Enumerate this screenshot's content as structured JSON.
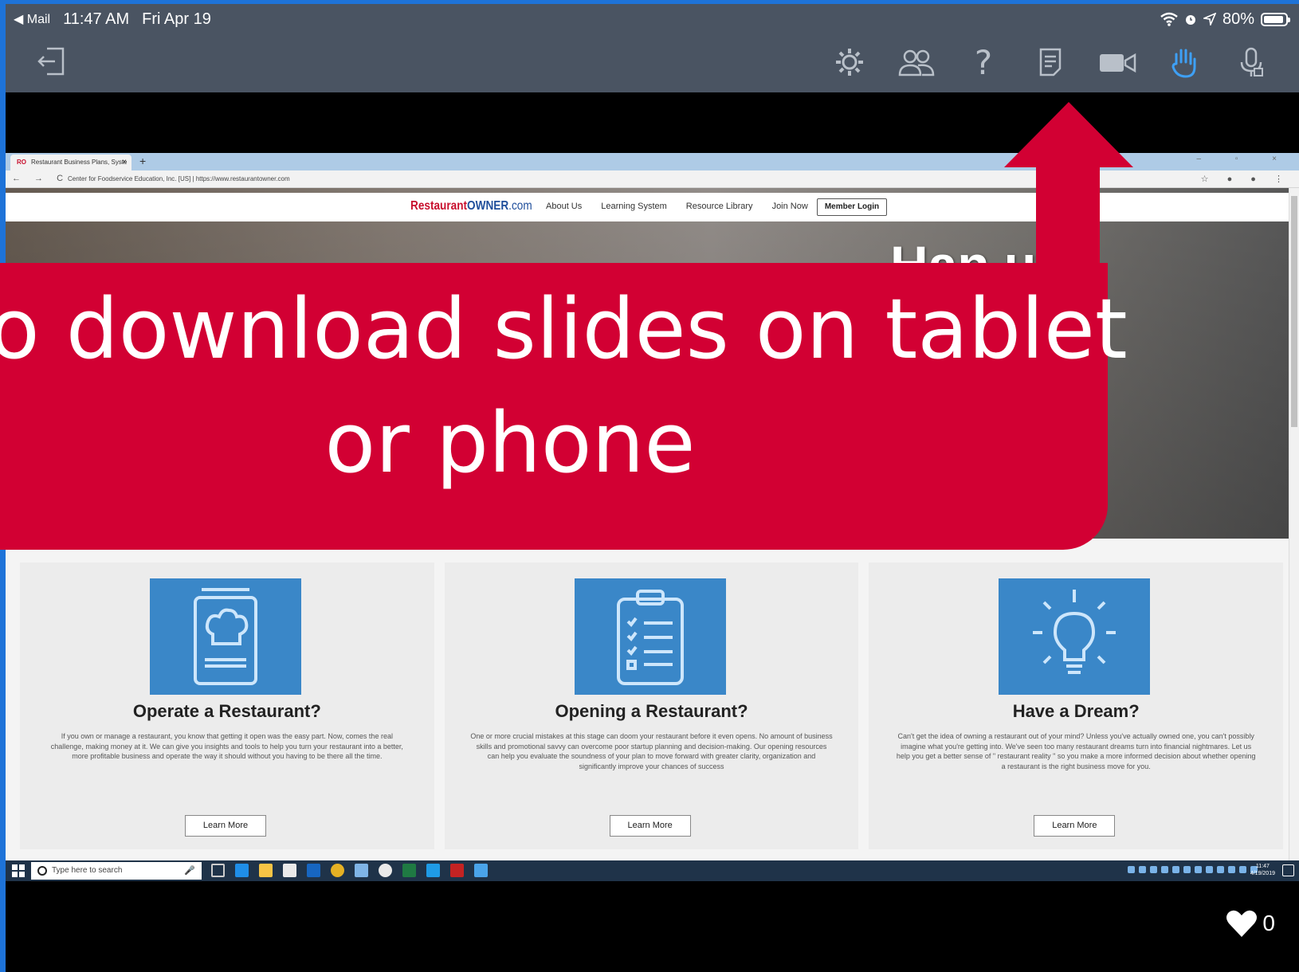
{
  "status_bar": {
    "back_label": "◀ Mail",
    "time": "11:47 AM",
    "date": "Fri Apr 19",
    "battery_text": "80%",
    "battery_level": 0.8
  },
  "app_toolbar": {
    "icons": [
      "exit-icon",
      "settings-gear-icon",
      "participants-icon",
      "help-icon",
      "notes-icon",
      "video-camera-icon",
      "raise-hand-icon",
      "microphone-icon"
    ],
    "help_glyph": "?",
    "active_color": "#3ea0f5"
  },
  "browser": {
    "tab_title": "Restaurant Business Plans, Syste",
    "tab_favicon": "RO",
    "tab_close": "×",
    "new_tab": "+",
    "address": "Center for Foodservice Education, Inc. [US]  |  https://www.restaurantowner.com"
  },
  "site": {
    "logo_part1": "Restaurant",
    "logo_part2": "OWNER",
    "logo_part3": ".com",
    "nav": [
      "About Us",
      "Learning System",
      "Resource Library",
      "Join Now"
    ],
    "member_login": "Member Login",
    "hero_heading": "Han    uts"
  },
  "cards": [
    {
      "title": "Operate a Restaurant?",
      "text": "If you own or manage a restaurant, you know that getting it open was the easy part. Now, comes the real challenge, making money at it. We can give you insights and tools to help you turn your restaurant into a better, more profitable business and operate the way it should without you having to be there all the time.",
      "button": "Learn More",
      "icon": "menu-chef-hat-icon"
    },
    {
      "title": "Opening a Restaurant?",
      "text": "One or more crucial mistakes at this stage can doom your restaurant before it even opens. No amount of business skills and promotional savvy can overcome poor startup planning and decision-making. Our opening resources can help you evaluate the soundness of your plan to move forward with greater clarity, organization and significantly improve your chances of success",
      "button": "Learn More",
      "icon": "clipboard-checklist-icon"
    },
    {
      "title": "Have a Dream?",
      "text": "Can't get the idea of owning a restaurant out of your mind? Unless you've actually owned one, you can't possibly imagine what you're getting into. We've seen too many restaurant dreams turn into financial nightmares. Let us help you get a better sense of \" restaurant reality \" so you make a more informed decision about whether opening a restaurant is the right business move for you.",
      "button": "Learn More",
      "icon": "lightbulb-icon"
    }
  ],
  "taskbar": {
    "search_placeholder": "Type here to search",
    "clock_time": "11:47",
    "clock_date": "4/19/2019"
  },
  "callout": {
    "line1": "o download slides on tablet",
    "line2": "or phone",
    "color": "#d20033"
  },
  "reactions": {
    "likes": "0"
  }
}
